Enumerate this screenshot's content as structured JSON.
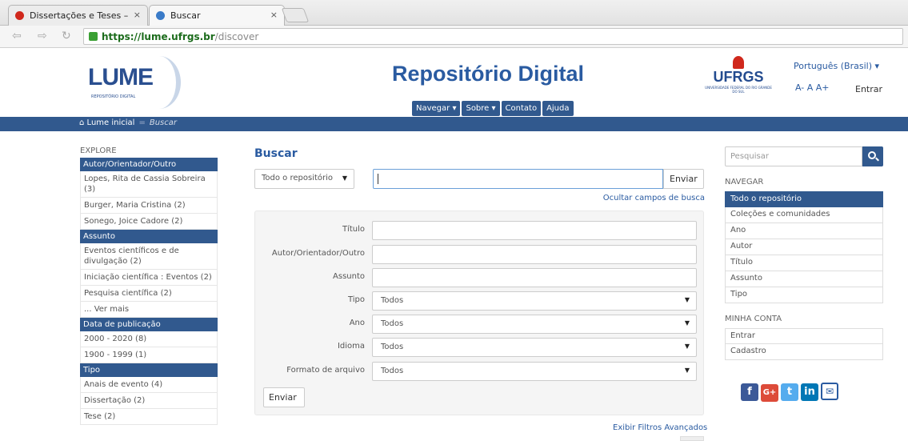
{
  "browser": {
    "tabs": [
      {
        "title": "Dissertações e Teses –",
        "close": "×"
      },
      {
        "title": "Buscar",
        "close": "×"
      }
    ],
    "url_host": "https://lume.ufrgs.br",
    "url_path": "/discover"
  },
  "header": {
    "logo_text": "LUME",
    "logo_subtitle": "REPOSITÓRIO DIGITAL",
    "site_title": "Repositório Digital",
    "nav": [
      "Navegar ▾",
      "Sobre ▾",
      "Contato",
      "Ajuda"
    ],
    "ufrgs_text": "UFRGS",
    "ufrgs_sub": "UNIVERSIDADE FEDERAL DO RIO GRANDE DO SUL",
    "language": "Português (Brasil) ▾",
    "font_sizes": "A- A A+",
    "login": "Entrar"
  },
  "breadcrumb": {
    "home": "Lume inicial",
    "separator": "=",
    "current": "Buscar"
  },
  "left": {
    "label": "EXPLORE",
    "facets": [
      {
        "head": "Autor/Orientador/Outro",
        "items": [
          "Lopes, Rita de Cassia Sobreira (3)",
          "Burger, Maria Cristina (2)",
          "Sonego, Joice Cadore (2)"
        ]
      },
      {
        "head": "Assunto",
        "items": [
          "Eventos científicos e de divulgação (2)",
          "Iniciação científica : Eventos (2)",
          "Pesquisa científica (2)",
          "... Ver mais"
        ]
      },
      {
        "head": "Data de publicação",
        "items": [
          "2000 - 2020 (8)",
          "1900 - 1999 (1)"
        ]
      },
      {
        "head": "Tipo",
        "items": [
          "Anais de evento (4)",
          "Dissertação (2)",
          "Tese (2)"
        ]
      }
    ]
  },
  "main": {
    "title": "Buscar",
    "scope": "Todo o repositório",
    "query": "",
    "query_button": "Enviar",
    "hide_fields": "Ocultar campos de busca",
    "fields": [
      {
        "label": "Título",
        "value": "",
        "select": false
      },
      {
        "label": "Autor/Orientador/Outro",
        "value": "",
        "select": false
      },
      {
        "label": "Assunto",
        "value": "",
        "select": false
      },
      {
        "label": "Tipo",
        "value": "Todos",
        "select": true
      },
      {
        "label": "Ano",
        "value": "Todos",
        "select": true
      },
      {
        "label": "Idioma",
        "value": "Todos",
        "select": true
      },
      {
        "label": "Formato de arquivo",
        "value": "Todos",
        "select": true
      }
    ],
    "submit": "Enviar",
    "advanced": "Exibir Filtros Avançados"
  },
  "right": {
    "search_placeholder": "Pesquisar",
    "browse_label": "NAVEGAR",
    "browse_items": [
      "Todo o repositório",
      "Coleções e comunidades",
      "Ano",
      "Autor",
      "Título",
      "Assunto",
      "Tipo"
    ],
    "account_label": "MINHA CONTA",
    "account_items": [
      "Entrar",
      "Cadastro"
    ]
  },
  "colors": {
    "brand": "#31598e",
    "link": "#2a5ba1",
    "ufrgs_red": "#d0281c"
  }
}
